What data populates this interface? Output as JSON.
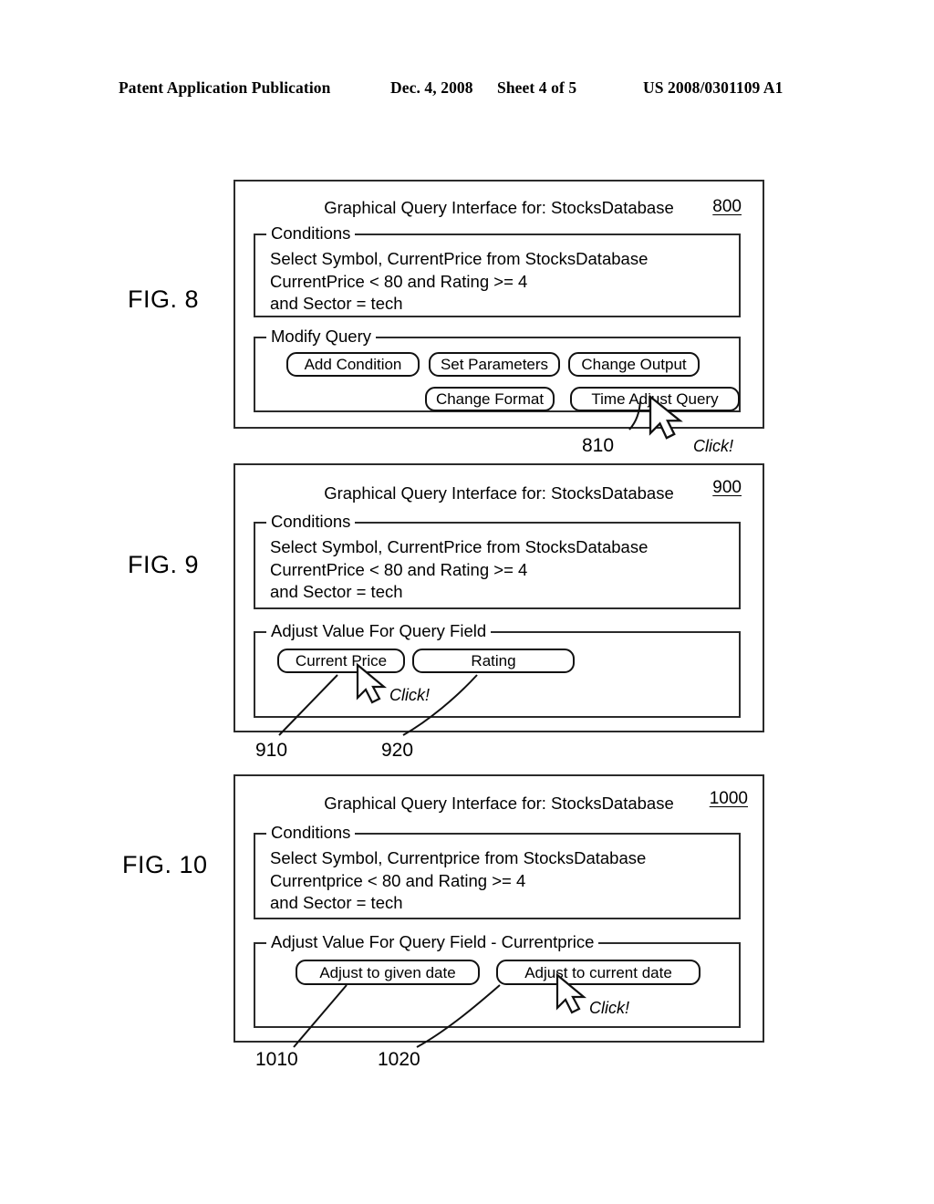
{
  "header": {
    "publication": "Patent Application Publication",
    "date": "Dec. 4, 2008",
    "sheet": "Sheet 4 of 5",
    "patent_number": "US 2008/0301109 A1"
  },
  "figures": [
    {
      "label": "FIG. 8",
      "window_title": "Graphical Query Interface for:  StocksDatabase",
      "window_ref": "800",
      "conditions": {
        "legend": "Conditions",
        "lines": [
          "Select Symbol, CurrentPrice from StocksDatabase",
          "CurrentPrice < 80 and Rating >= 4",
          "and Sector = tech"
        ]
      },
      "actions": {
        "legend": "Modify Query",
        "buttons": [
          "Add Condition",
          "Set Parameters",
          "Change Output",
          "Change Format",
          "Time Adjust Query"
        ]
      },
      "callouts": [
        {
          "ref": "810",
          "click_label": "Click!"
        }
      ]
    },
    {
      "label": "FIG. 9",
      "window_title": "Graphical Query Interface for:  StocksDatabase",
      "window_ref": "900",
      "conditions": {
        "legend": "Conditions",
        "lines": [
          "Select Symbol, CurrentPrice from StocksDatabase",
          "CurrentPrice < 80 and Rating >= 4",
          "and Sector = tech"
        ]
      },
      "actions": {
        "legend": "Adjust Value For Query Field",
        "buttons": [
          "Current Price",
          "Rating"
        ]
      },
      "callouts": [
        {
          "ref": "910",
          "click_label": "Click!"
        },
        {
          "ref": "920"
        }
      ]
    },
    {
      "label": "FIG. 10",
      "window_title": "Graphical Query Interface for:  StocksDatabase",
      "window_ref": "1000",
      "conditions": {
        "legend": "Conditions",
        "lines": [
          "Select Symbol, Currentprice from StocksDatabase",
          "Currentprice < 80 and Rating >= 4",
          "and Sector = tech"
        ]
      },
      "actions": {
        "legend": "Adjust Value For Query Field - Currentprice",
        "buttons": [
          "Adjust to given date",
          "Adjust to current date"
        ]
      },
      "callouts": [
        {
          "ref": "1010"
        },
        {
          "ref": "1020",
          "click_label": "Click!"
        }
      ]
    }
  ],
  "icons": {
    "cursor": "mouse-cursor-arrow-icon"
  },
  "colors": {
    "ink": "#000000",
    "line": "#2b2b2b",
    "paper": "#ffffff"
  }
}
